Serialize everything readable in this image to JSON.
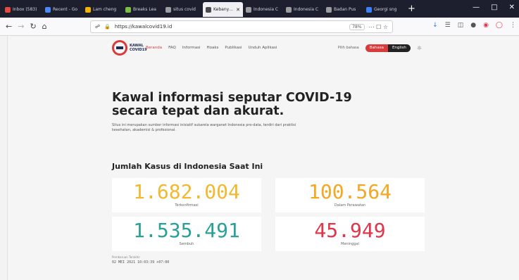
{
  "browser": {
    "tabs": [
      {
        "title": "Inbox (583)",
        "fav": "#e84a3d",
        "active": false
      },
      {
        "title": "Recent - Go",
        "fav": "#4a8af4",
        "active": false
      },
      {
        "title": "Lam cheng",
        "fav": "#f4b400",
        "active": false
      },
      {
        "title": "Breaks Lea",
        "fav": "#7bc043",
        "active": false
      },
      {
        "title": "situs covid",
        "fav": "#9e9e9e",
        "active": false
      },
      {
        "title": "Kebanyak",
        "fav": "#4a4a4a",
        "active": true
      },
      {
        "title": "Indonesia C",
        "fav": "#9e9e9e",
        "active": false
      },
      {
        "title": "Indonesia C",
        "fav": "#9e9e9e",
        "active": false
      },
      {
        "title": "Badan Pus",
        "fav": "#9e9e9e",
        "active": false
      },
      {
        "title": "Georgi sng",
        "fav": "#3b82f6",
        "active": false
      }
    ],
    "url": "https://kawalcovid19.id",
    "zoom": "78%"
  },
  "site": {
    "logo_text": "KAWAL COVID19",
    "nav": [
      "Beranda",
      "FAQ",
      "Informasi",
      "Hoaks",
      "Publikasi",
      "Unduh Aplikasi"
    ],
    "lang_label": "Pilih bahasa",
    "lang_id": "Bahasa",
    "lang_en": "English"
  },
  "hero": {
    "title": "Kawal informasi seputar COVID-19 secara tepat dan akurat.",
    "subtitle": "Situs ini merupakan sumber informasi inisiatif sukarela warganet Indonesia pro-data, terdiri dari praktisi kesehatan, akademisi & profesional."
  },
  "stats": {
    "title": "Jumlah Kasus di Indonesia Saat Ini",
    "confirmed": {
      "value": "1.682.004",
      "label": "Terkonfirmasi",
      "color": "#f2b930"
    },
    "active": {
      "value": "100.564",
      "label": "Dalam Perawatan",
      "color": "#f5a623"
    },
    "recovered": {
      "value": "1.535.491",
      "label": "Sembuh",
      "color": "#2aa198"
    },
    "deaths": {
      "value": "45.949",
      "label": "Meninggal",
      "color": "#e0354a"
    },
    "updated_label": "Pembaruan Terakhir",
    "updated": "02 MEI 2021 10:03:39 +07:00"
  }
}
